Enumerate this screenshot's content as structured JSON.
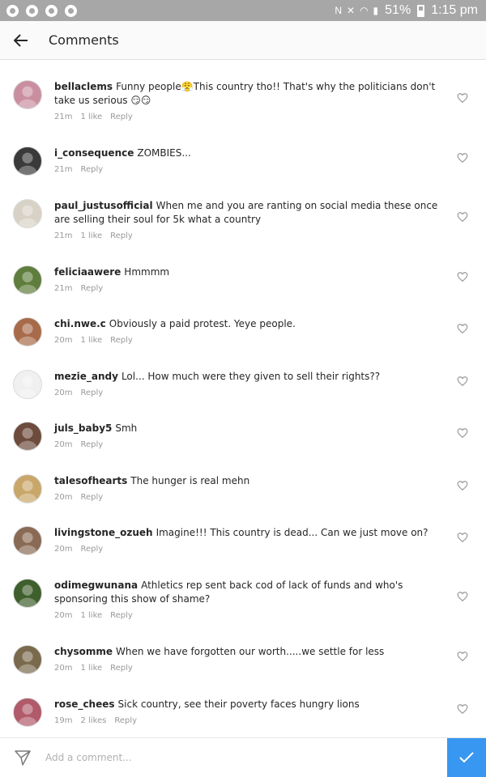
{
  "status_bar": {
    "battery": "51%",
    "time": "1:15 pm",
    "icons": [
      "notification-dot-icon",
      "notification-dot-icon",
      "notification-dot-icon",
      "notification-dot-icon",
      "nfc-icon",
      "mute-icon",
      "wifi-icon",
      "signal-icon",
      "battery-icon"
    ]
  },
  "header": {
    "title": "Comments",
    "back_icon": "back-arrow-icon"
  },
  "comments": [
    {
      "username": "bellaclems",
      "text": "Funny people😤This country tho!! That's why the politicians don't take us serious 😏😏",
      "time": "21m",
      "likes": "1 like",
      "reply": "Reply",
      "avatar_color": "#c98fa0"
    },
    {
      "username": "i_consequence",
      "text": "ZOMBIES...",
      "time": "21m",
      "likes": "",
      "reply": "Reply",
      "avatar_color": "#3a3a3a"
    },
    {
      "username": "paul_justusofficial",
      "text": "When me and you are ranting on social media these once are selling their soul for 5k what a country",
      "time": "21m",
      "likes": "1 like",
      "reply": "Reply",
      "avatar_color": "#d8d2c6"
    },
    {
      "username": "feliciaawere",
      "text": "Hmmmm",
      "time": "21m",
      "likes": "",
      "reply": "Reply",
      "avatar_color": "#5f7d3c"
    },
    {
      "username": "chi.nwe.c",
      "text": "Obviously a paid protest. Yeye people.",
      "time": "20m",
      "likes": "1 like",
      "reply": "Reply",
      "avatar_color": "#a86b4a"
    },
    {
      "username": "mezie_andy",
      "text": "Lol... How much were they given to sell their rights??",
      "time": "20m",
      "likes": "",
      "reply": "Reply",
      "avatar_color": "#f0f0f0"
    },
    {
      "username": "juls_baby5",
      "text": "Smh",
      "time": "20m",
      "likes": "",
      "reply": "Reply",
      "avatar_color": "#6d4c3d"
    },
    {
      "username": "talesofhearts",
      "text": "The hunger is real mehn",
      "time": "20m",
      "likes": "",
      "reply": "Reply",
      "avatar_color": "#c9a76b"
    },
    {
      "username": "livingstone_ozueh",
      "text": "Imagine!!! This country is dead... Can we just move on?",
      "time": "20m",
      "likes": "",
      "reply": "Reply",
      "avatar_color": "#8a6a55"
    },
    {
      "username": "odimegwunana",
      "text": "Athletics rep sent back cod of lack of funds and who's sponsoring this show of shame?",
      "time": "20m",
      "likes": "1 like",
      "reply": "Reply",
      "avatar_color": "#3f5f2c"
    },
    {
      "username": "chysomme",
      "text": "When we have forgotten our worth.....we settle for less",
      "time": "20m",
      "likes": "1 like",
      "reply": "Reply",
      "avatar_color": "#7a6a4d"
    },
    {
      "username": "rose_chees",
      "text": "Sick country, see their poverty faces hungry lions",
      "time": "19m",
      "likes": "2 likes",
      "reply": "Reply",
      "avatar_color": "#b05a6a"
    }
  ],
  "composer": {
    "placeholder": "Add a comment...",
    "post_button_color": "#3897f0"
  }
}
